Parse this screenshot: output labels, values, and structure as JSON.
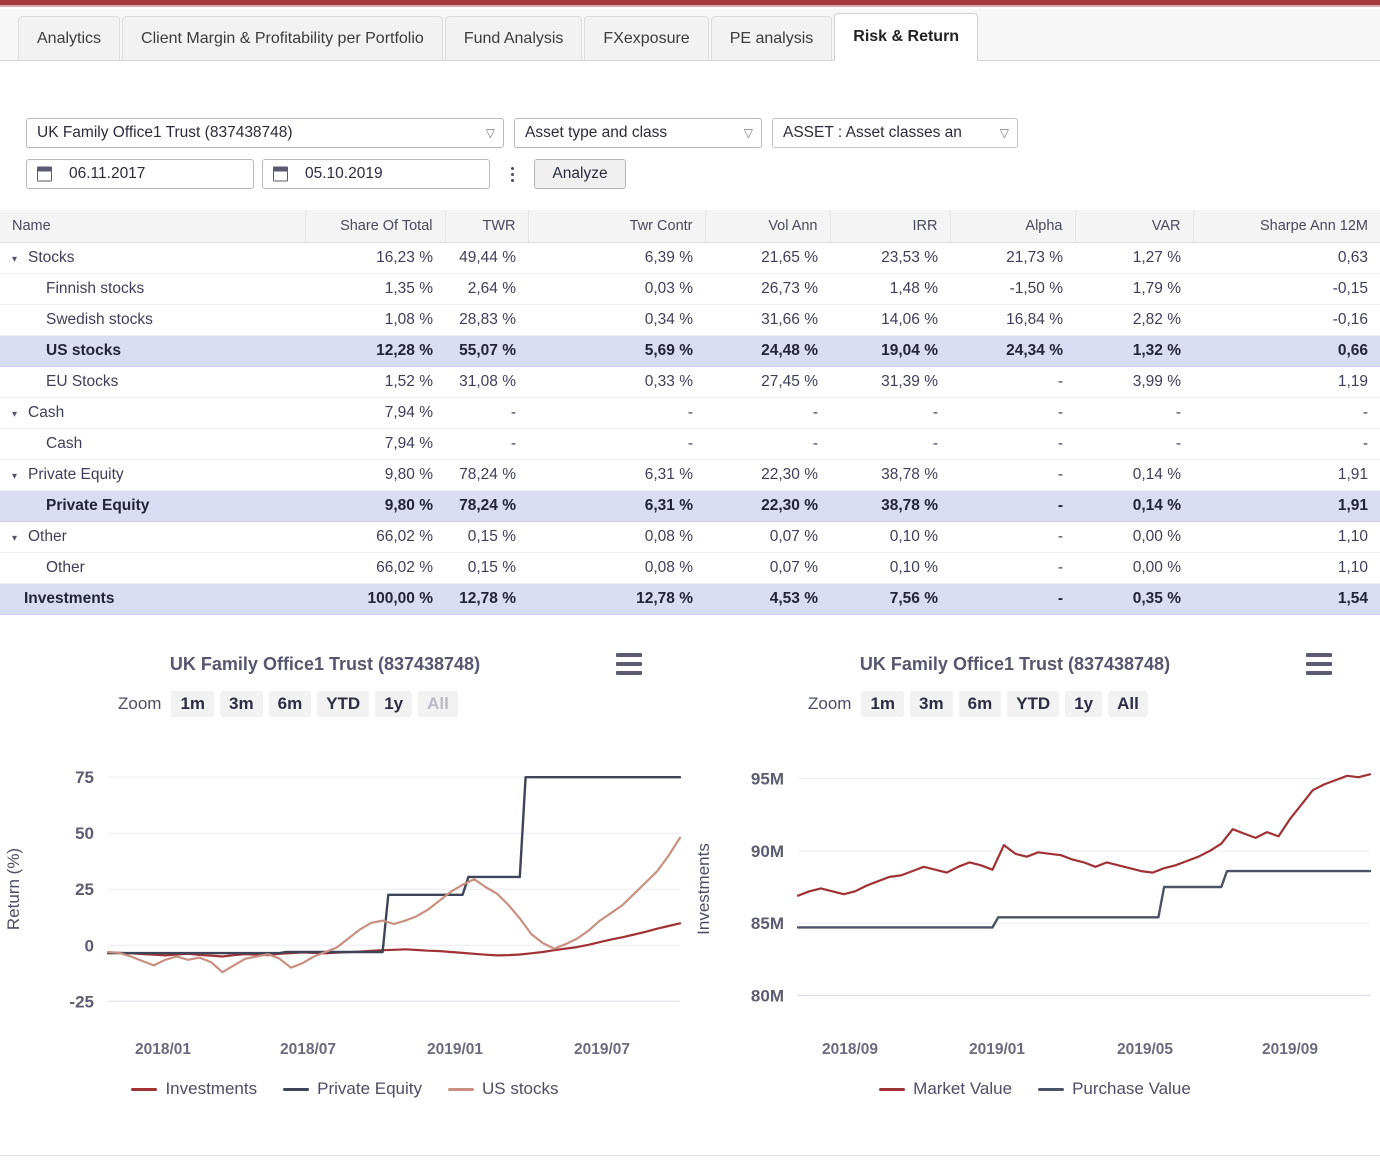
{
  "tabs": [
    {
      "label": "Analytics",
      "active": false
    },
    {
      "label": "Client Margin & Profitability per Portfolio",
      "active": false
    },
    {
      "label": "Fund Analysis",
      "active": false
    },
    {
      "label": "FXexposure",
      "active": false
    },
    {
      "label": "PE analysis",
      "active": false
    },
    {
      "label": "Risk & Return",
      "active": true
    }
  ],
  "filters": {
    "portfolio": "UK Family Office1 Trust (837438748)",
    "grouping": "Asset type and class",
    "asset": "ASSET : Asset classes an",
    "date_from": "06.11.2017",
    "date_to": "05.10.2019",
    "analyze_label": "Analyze"
  },
  "table": {
    "columns": [
      "Name",
      "Share Of Total",
      "TWR",
      "Twr Contr",
      "Vol Ann",
      "IRR",
      "Alpha",
      "VAR",
      "Sharpe Ann 12M"
    ],
    "rows": [
      {
        "name": "Stocks",
        "level": 0,
        "expander": "▾",
        "selected": false,
        "values": [
          "16,23 %",
          "49,44 %",
          "6,39 %",
          "21,65 %",
          "23,53 %",
          "21,73 %",
          "1,27 %",
          "0,63"
        ]
      },
      {
        "name": "Finnish stocks",
        "level": 1,
        "expander": "",
        "selected": false,
        "values": [
          "1,35 %",
          "2,64 %",
          "0,03 %",
          "26,73 %",
          "1,48 %",
          "-1,50 %",
          "1,79 %",
          "-0,15"
        ]
      },
      {
        "name": "Swedish stocks",
        "level": 1,
        "expander": "",
        "selected": false,
        "values": [
          "1,08 %",
          "28,83 %",
          "0,34 %",
          "31,66 %",
          "14,06 %",
          "16,84 %",
          "2,82 %",
          "-0,16"
        ]
      },
      {
        "name": "US stocks",
        "level": 1,
        "expander": "",
        "selected": true,
        "values": [
          "12,28 %",
          "55,07 %",
          "5,69 %",
          "24,48 %",
          "19,04 %",
          "24,34 %",
          "1,32 %",
          "0,66"
        ]
      },
      {
        "name": "EU Stocks",
        "level": 1,
        "expander": "",
        "selected": false,
        "values": [
          "1,52 %",
          "31,08 %",
          "0,33 %",
          "27,45 %",
          "31,39 %",
          "-",
          "3,99 %",
          "1,19"
        ]
      },
      {
        "name": "Cash",
        "level": 0,
        "expander": "▾",
        "selected": false,
        "values": [
          "7,94 %",
          "-",
          "-",
          "-",
          "-",
          "-",
          "-",
          "-"
        ]
      },
      {
        "name": "Cash",
        "level": 1,
        "expander": "",
        "selected": false,
        "values": [
          "7,94 %",
          "-",
          "-",
          "-",
          "-",
          "-",
          "-",
          "-"
        ]
      },
      {
        "name": "Private Equity",
        "level": 0,
        "expander": "▾",
        "selected": false,
        "values": [
          "9,80 %",
          "78,24 %",
          "6,31 %",
          "22,30 %",
          "38,78 %",
          "-",
          "0,14 %",
          "1,91"
        ]
      },
      {
        "name": "Private Equity",
        "level": 1,
        "expander": "",
        "selected": true,
        "values": [
          "9,80 %",
          "78,24 %",
          "6,31 %",
          "22,30 %",
          "38,78 %",
          "-",
          "0,14 %",
          "1,91"
        ]
      },
      {
        "name": "Other",
        "level": 0,
        "expander": "▾",
        "selected": false,
        "values": [
          "66,02 %",
          "0,15 %",
          "0,08 %",
          "0,07 %",
          "0,10 %",
          "-",
          "0,00 %",
          "1,10"
        ]
      },
      {
        "name": "Other",
        "level": 1,
        "expander": "",
        "selected": false,
        "values": [
          "66,02 %",
          "0,15 %",
          "0,08 %",
          "0,07 %",
          "0,10 %",
          "-",
          "0,00 %",
          "1,10"
        ]
      },
      {
        "name": "Investments",
        "level": "tot",
        "expander": "",
        "selected": true,
        "values": [
          "100,00 %",
          "12,78 %",
          "12,78 %",
          "4,53 %",
          "7,56 %",
          "-",
          "0,35 %",
          "1,54"
        ]
      }
    ]
  },
  "chart_data": [
    {
      "id": "return-chart",
      "type": "line",
      "title": "UK Family Office1 Trust (837438748)",
      "ylabel": "Return (%)",
      "xlabel": "",
      "ylim": [
        -30,
        85
      ],
      "yticks": [
        75,
        50,
        25,
        0,
        -25
      ],
      "xticks": [
        "2018/01",
        "2018/07",
        "2019/01",
        "2019/07"
      ],
      "grid": true,
      "legend_position": "bottom",
      "zoom_label": "Zoom",
      "zoom_options": [
        "1m",
        "3m",
        "6m",
        "YTD",
        "1y",
        "All"
      ],
      "zoom_selected": "All",
      "menu_icon": "hamburger-menu-icon",
      "series": [
        {
          "name": "Investments",
          "color": "#a03236",
          "x": [
            0,
            2,
            4,
            6,
            8,
            10,
            12,
            14,
            16,
            18,
            20,
            22,
            24,
            26,
            28,
            30,
            32,
            34,
            36,
            38,
            40,
            42,
            44,
            46,
            48,
            50,
            52,
            54,
            56,
            58,
            60,
            62,
            64,
            66,
            68,
            70,
            72,
            74,
            76,
            78,
            80,
            82,
            84,
            86,
            88,
            90,
            92,
            94,
            96,
            98,
            100
          ],
          "values": [
            -3.5,
            -3.4,
            -3.6,
            -3.9,
            -4.2,
            -4.5,
            -4.1,
            -3.8,
            -4.3,
            -4.6,
            -5.0,
            -4.4,
            -4.0,
            -4.2,
            -4.4,
            -3.8,
            -3.5,
            -3.2,
            -3.4,
            -3.6,
            -3.3,
            -3.1,
            -2.8,
            -2.5,
            -2.2,
            -2.0,
            -1.8,
            -2.1,
            -2.4,
            -2.6,
            -3.0,
            -3.4,
            -3.8,
            -4.2,
            -4.5,
            -4.4,
            -4.1,
            -3.6,
            -3.0,
            -2.2,
            -1.5,
            -0.8,
            0.2,
            1.4,
            2.6,
            3.6,
            4.8,
            6.0,
            7.4,
            8.6,
            9.8
          ]
        },
        {
          "name": "Private Equity",
          "color": "#3e4558",
          "step": true,
          "x": [
            0,
            30,
            31,
            48,
            49,
            62,
            63,
            72,
            73,
            100
          ],
          "values": [
            -3.5,
            -3.5,
            -3.0,
            -3.0,
            22.5,
            22.5,
            30.5,
            30.5,
            75.0,
            75.0
          ]
        },
        {
          "name": "US stocks",
          "color": "#c89080",
          "x": [
            0,
            2,
            4,
            6,
            8,
            10,
            12,
            14,
            16,
            18,
            20,
            22,
            24,
            26,
            28,
            30,
            32,
            34,
            36,
            38,
            40,
            42,
            44,
            46,
            48,
            50,
            52,
            54,
            56,
            58,
            60,
            62,
            64,
            66,
            68,
            70,
            72,
            74,
            76,
            78,
            80,
            82,
            84,
            86,
            88,
            90,
            92,
            94,
            96,
            98,
            100
          ],
          "values": [
            -3.0,
            -3.4,
            -5.0,
            -7.0,
            -9.0,
            -6.5,
            -5.0,
            -6.5,
            -5.5,
            -7.5,
            -12.0,
            -9.0,
            -6.0,
            -5.0,
            -4.0,
            -6.0,
            -10.0,
            -8.0,
            -5.0,
            -3.0,
            -1.0,
            3.0,
            7.0,
            10.0,
            11.0,
            9.5,
            11.0,
            13.0,
            16.0,
            20.0,
            24.0,
            27.0,
            29.5,
            26.0,
            23.0,
            18.0,
            12.0,
            5.0,
            1.0,
            -1.5,
            0.5,
            3.0,
            6.5,
            11.0,
            14.5,
            18.0,
            23.0,
            28.0,
            33.0,
            40.0,
            48.0
          ]
        }
      ]
    },
    {
      "id": "value-chart",
      "type": "line",
      "title": "UK Family Office1 Trust (837438748)",
      "ylabel": "Investments",
      "xlabel": "",
      "ylim": [
        78500000,
        96500000
      ],
      "yticks": [
        "95M",
        "90M",
        "85M",
        "80M"
      ],
      "ytick_values": [
        95000000,
        90000000,
        85000000,
        80000000
      ],
      "xticks": [
        "2018/09",
        "2019/01",
        "2019/05",
        "2019/09"
      ],
      "grid": true,
      "legend_position": "bottom",
      "zoom_label": "Zoom",
      "zoom_options": [
        "1m",
        "3m",
        "6m",
        "YTD",
        "1y",
        "All"
      ],
      "zoom_selected": "All",
      "menu_icon": "hamburger-menu-icon",
      "series": [
        {
          "name": "Market Value",
          "color": "#a03236",
          "x": [
            0,
            2,
            4,
            6,
            8,
            10,
            12,
            14,
            16,
            18,
            20,
            22,
            24,
            26,
            28,
            30,
            32,
            34,
            36,
            38,
            40,
            42,
            44,
            46,
            48,
            50,
            52,
            54,
            56,
            58,
            60,
            62,
            64,
            66,
            68,
            70,
            72,
            74,
            76,
            78,
            80,
            82,
            84,
            86,
            88,
            90,
            92,
            94,
            96,
            98,
            100
          ],
          "values": [
            86.9,
            87.2,
            87.4,
            87.2,
            87.0,
            87.2,
            87.6,
            87.9,
            88.2,
            88.3,
            88.6,
            88.9,
            88.7,
            88.5,
            88.9,
            89.2,
            89.0,
            88.7,
            90.4,
            89.8,
            89.6,
            89.9,
            89.8,
            89.7,
            89.4,
            89.2,
            88.9,
            89.2,
            89.0,
            88.8,
            88.6,
            88.5,
            88.8,
            89.0,
            89.3,
            89.6,
            90.0,
            90.5,
            91.5,
            91.2,
            90.9,
            91.3,
            91.0,
            92.2,
            93.2,
            94.2,
            94.6,
            94.9,
            95.2,
            95.1,
            95.3
          ]
        },
        {
          "name": "Purchase Value",
          "color": "#4a5266",
          "step": true,
          "x": [
            0,
            34,
            35,
            63,
            64,
            74,
            75,
            100
          ],
          "values": [
            84.7,
            84.7,
            85.4,
            85.4,
            87.5,
            87.5,
            88.6,
            88.6
          ]
        }
      ]
    }
  ]
}
